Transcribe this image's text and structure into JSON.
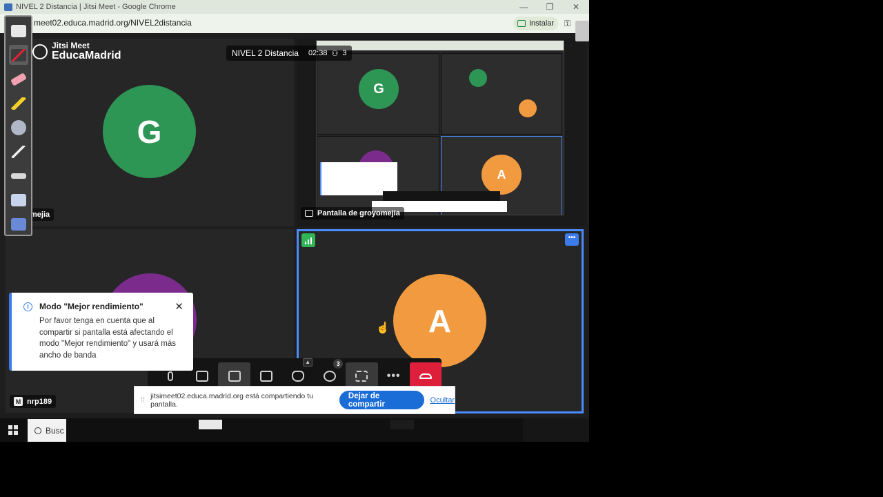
{
  "browser": {
    "window_title": "NIVEL 2 Distancia | Jitsi Meet - Google Chrome",
    "url": "meet02.educa.madrid.org/NIVEL2distancia",
    "install_label": "Instalar"
  },
  "brand": {
    "line1": "Jitsi Meet",
    "line2": "EducaMadrid"
  },
  "meeting": {
    "name": "NIVEL 2 Distancia",
    "timer": "02:38",
    "participant_count": "3"
  },
  "participants": {
    "g": {
      "initial": "G",
      "name_fragment": "mejia",
      "color": "#2e9655"
    },
    "share_label": "Pantalla de groyomejia",
    "a": {
      "initial": "A",
      "color": "#f29a3f"
    },
    "m": {
      "badge": "M",
      "name": "nrp189",
      "color": "#7b2b8c"
    }
  },
  "notification": {
    "title": "Modo \"Mejor rendimiento\"",
    "message": "Por favor tenga en cuenta que al compartir si pantalla está afectando el modo \"Mejor rendimiento\" y usará más ancho de banda"
  },
  "toolbar": {
    "participants_badge": "3"
  },
  "share_banner": {
    "message": "jitsimeet02.educa.madrid.org está compartiendo tu pantalla.",
    "stop_label": "Dejar de compartir",
    "hide_label": "Ocultar"
  },
  "taskbar": {
    "search_placeholder": "Busc"
  },
  "colors": {
    "accent": "#3b7bea",
    "hangup": "#dd1f3b",
    "speaking": "#31b456"
  }
}
